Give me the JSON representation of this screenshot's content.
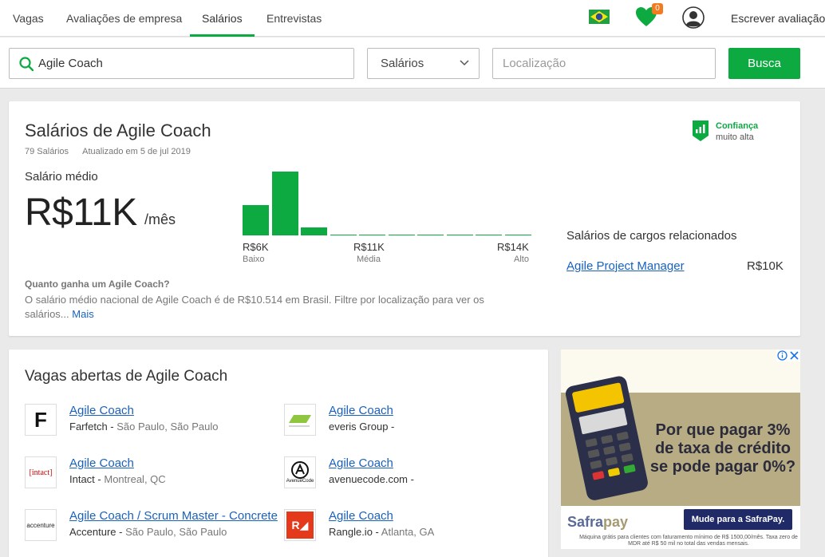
{
  "nav": {
    "tabs": [
      "Vagas",
      "Avaliações de empresa",
      "Salários",
      "Entrevistas"
    ],
    "active_tab": "Salários",
    "saved_count": "0",
    "write_review": "Escrever avaliação"
  },
  "search": {
    "keyword": "Agile Coach",
    "category": "Salários",
    "location_placeholder": "Localização",
    "button": "Busca"
  },
  "salary": {
    "title": "Salários de Agile Coach",
    "count": "79 Salários",
    "updated": "Atualizado em 5 de jul 2019",
    "confidence_label": "Confiança",
    "confidence_value": "muito alta",
    "average_label": "Salário médio",
    "average_value": "R$11K",
    "unit": "/mês",
    "range": {
      "low": "R$6K",
      "low_label": "Baixo",
      "mid": "R$11K",
      "mid_label": "Média",
      "high": "R$14K",
      "high_label": "Alto"
    },
    "histogram_levels": [
      0.48,
      1.0,
      0.12,
      0.01,
      0.01,
      0.01,
      0.01,
      0.01,
      0.01,
      0.01
    ],
    "faq_question": "Quanto ganha um Agile Coach?",
    "faq_answer": "O salário médio nacional de Agile Coach é de R$10.514 em Brasil. Filtre por localização para ver os salários...",
    "faq_more": "Mais",
    "related_title": "Salários de cargos relacionados",
    "related": [
      {
        "name": "Agile Project Manager",
        "value": "R$10K"
      }
    ]
  },
  "jobs": {
    "title": "Vagas abertas de Agile Coach",
    "items": [
      {
        "title": "Agile Coach",
        "company": "Farfetch",
        "location": "São Paulo, São Paulo",
        "logo": "F"
      },
      {
        "title": "Agile Coach",
        "company": "everis Group",
        "location": "",
        "logo": ""
      },
      {
        "title": "Agile Coach",
        "company": "Intact",
        "location": "Montreal, QC",
        "logo": "[intact]"
      },
      {
        "title": "Agile Coach",
        "company": "avenuecode.com",
        "location": "",
        "logo": "AvenueCode"
      },
      {
        "title": "Agile Coach / Scrum Master - Concrete",
        "company": "Accenture",
        "location": "São Paulo, São Paulo",
        "logo": "accenture"
      },
      {
        "title": "Agile Coach",
        "company": "Rangle.io",
        "location": "Atlanta, GA",
        "logo": "R◢"
      }
    ]
  },
  "ad": {
    "headline": "Por que pagar 3% de taxa de crédito se pode pagar 0%?",
    "brand_a": "Safra",
    "brand_b": "pay",
    "cta": "Mude para a SafraPay.",
    "fine_print": "Máquina grátis para clientes com faturamento mínimo de R$ 1500,00/mês. Taxa zero de MDR até R$ 50 mil no total das vendas mensais."
  },
  "colors": {
    "accent": "#0caa41",
    "link": "#1861bf",
    "badge": "#f47a20"
  }
}
